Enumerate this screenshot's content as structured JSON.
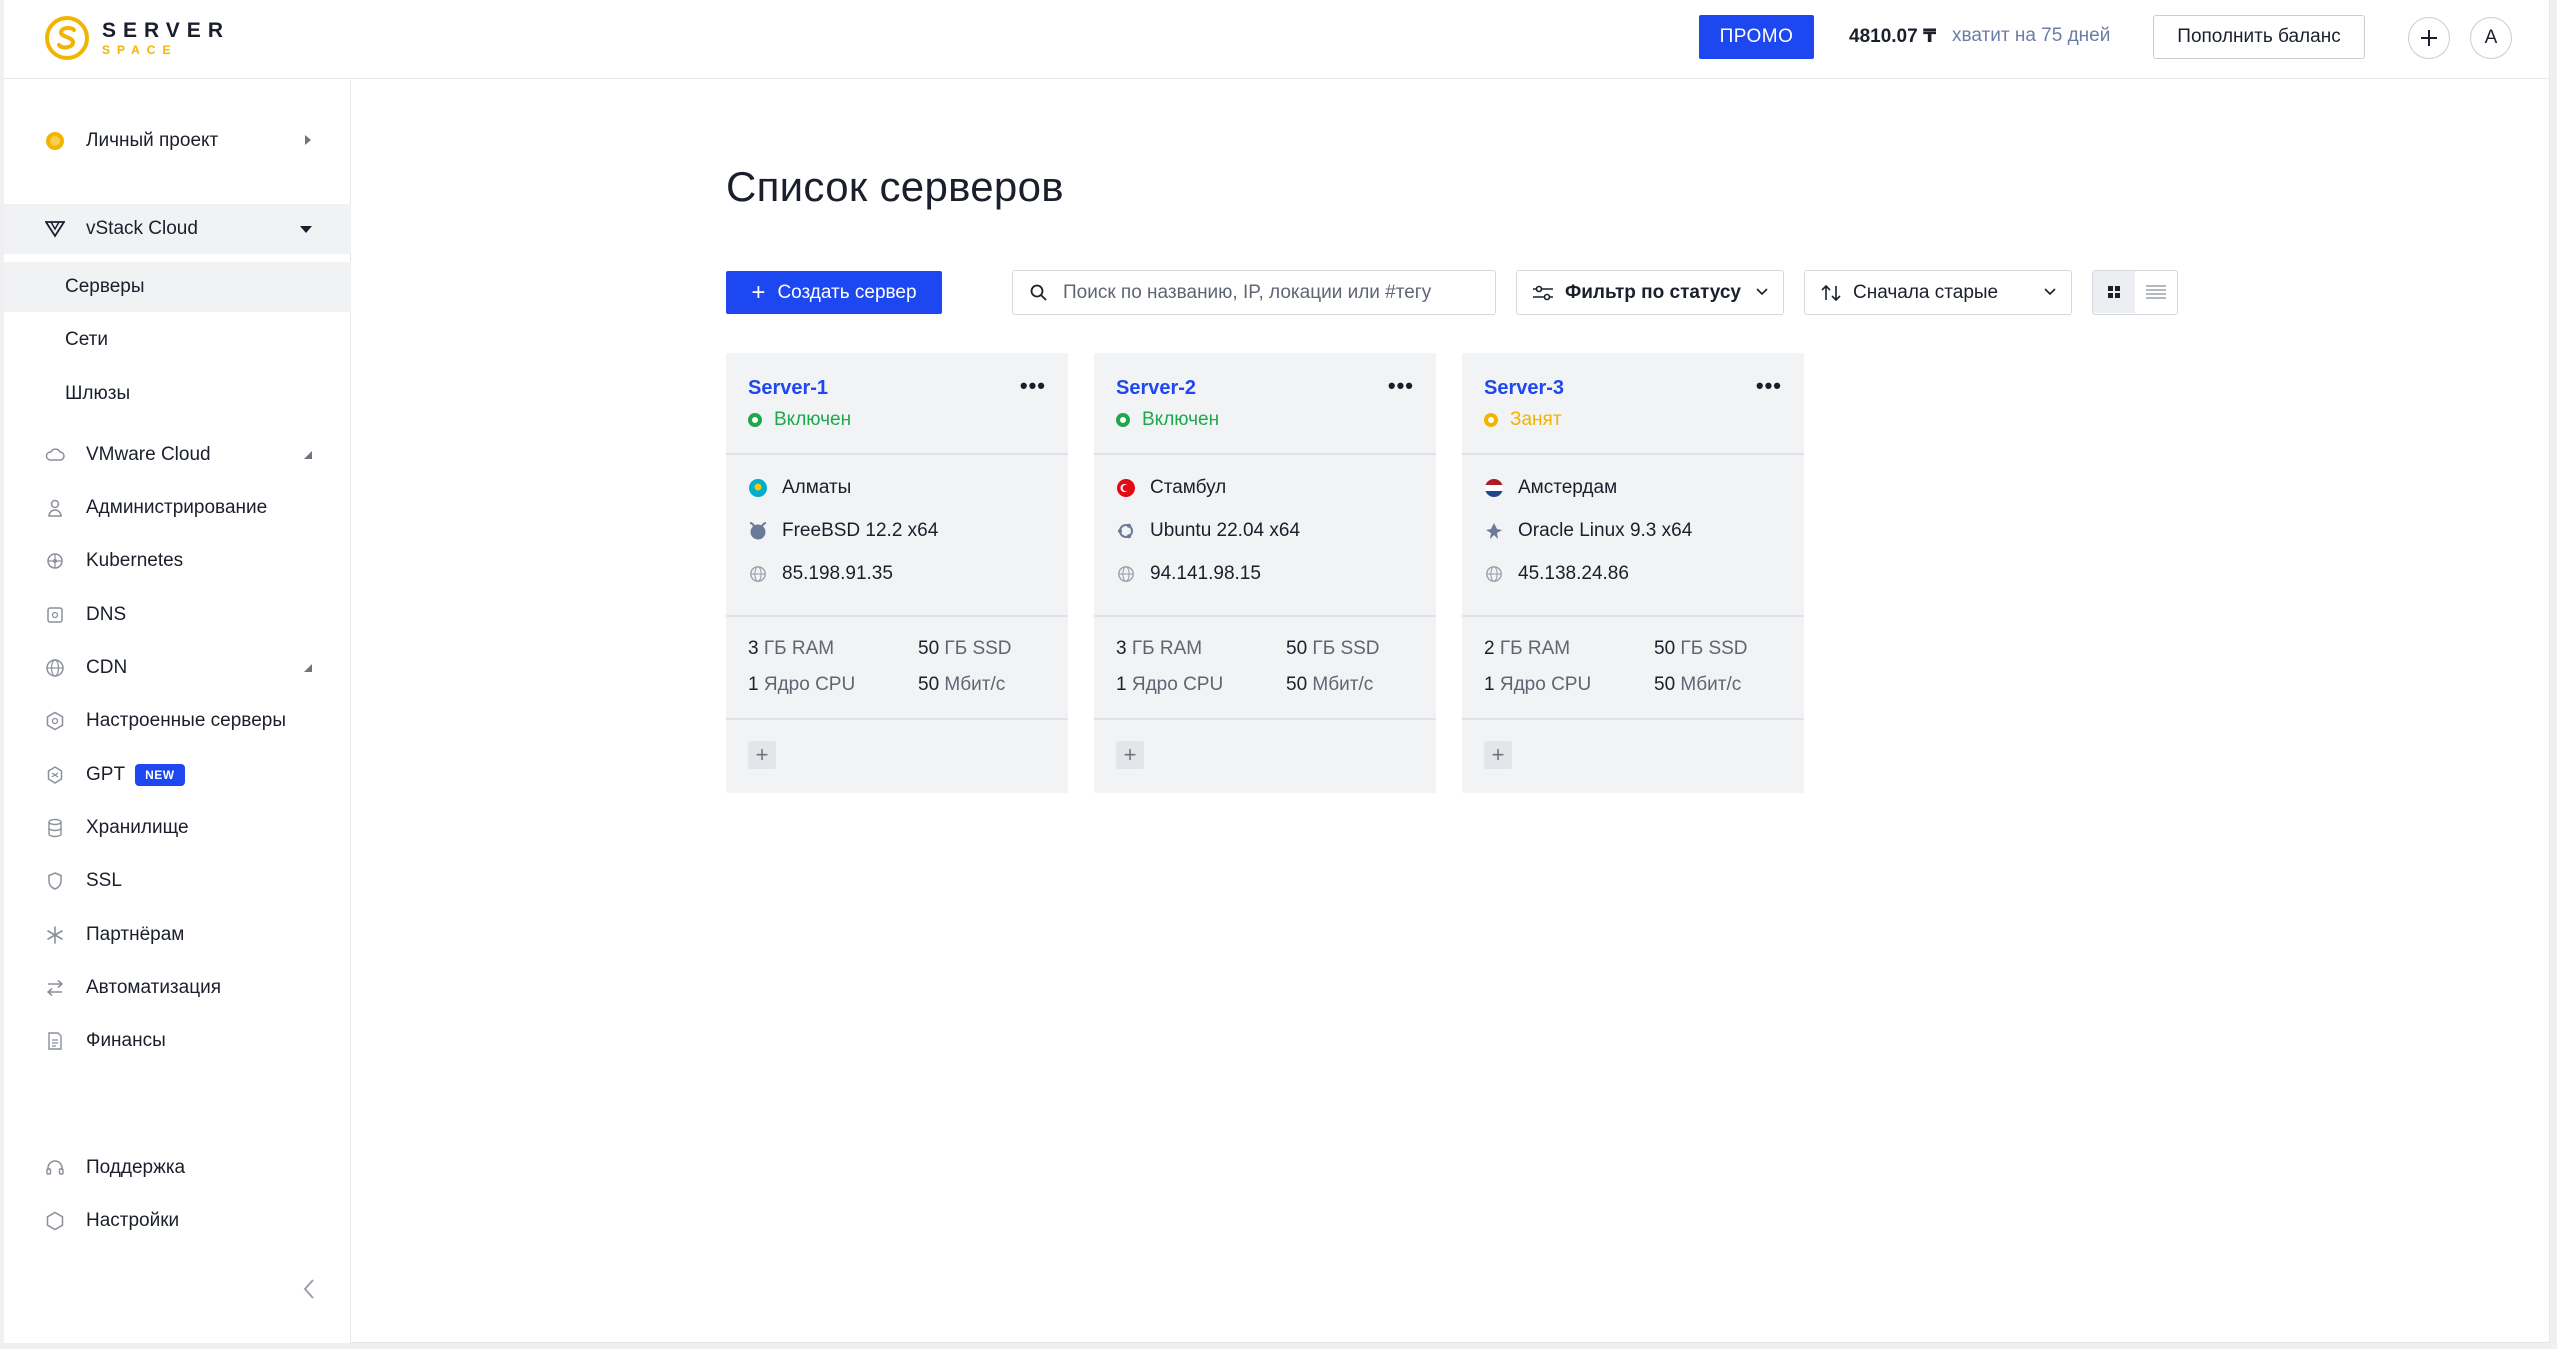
{
  "brand": {
    "line1": "SERVER",
    "line2": "SPACE",
    "accent": "#f2b400"
  },
  "header": {
    "promo_label": "ПРОМО",
    "balance": "4810.07 ₸",
    "balance_days": "хватит на 75 дней",
    "topup_label": "Пополнить баланс",
    "add_icon": "+",
    "avatar_letter": "A"
  },
  "sidebar": {
    "project": "Личный проект",
    "groups": [
      {
        "label": "vStack Cloud",
        "icon": "vstack-icon"
      },
      {
        "label": "VMware Cloud",
        "icon": "cloud-icon"
      },
      {
        "label": "Администрирование",
        "icon": "user-icon"
      },
      {
        "label": "Kubernetes",
        "icon": "kubernetes-icon"
      },
      {
        "label": "DNS",
        "icon": "dns-icon"
      },
      {
        "label": "CDN",
        "icon": "globe-icon"
      },
      {
        "label": "Настроенные серверы",
        "icon": "hexagon-icon"
      },
      {
        "label": "GPT",
        "icon": "gpt-icon",
        "badge": "NEW"
      },
      {
        "label": "Хранилище",
        "icon": "database-icon"
      },
      {
        "label": "SSL",
        "icon": "shield-icon"
      },
      {
        "label": "Партнёрам",
        "icon": "asterisk-icon"
      },
      {
        "label": "Автоматизация",
        "icon": "arrows-icon"
      },
      {
        "label": "Финансы",
        "icon": "document-icon"
      }
    ],
    "subitems": [
      "Серверы",
      "Сети",
      "Шлюзы"
    ],
    "bottom": [
      {
        "label": "Поддержка",
        "icon": "headset-icon"
      },
      {
        "label": "Настройки",
        "icon": "settings-icon"
      }
    ]
  },
  "main": {
    "title": "Список серверов",
    "create_label": "Создать сервер",
    "search_placeholder": "Поиск по названию, IP, локации или #тегу",
    "filter_label": "Фильтр по статусу",
    "sort_label": "Сначала старые"
  },
  "servers": [
    {
      "name": "Server-1",
      "status": "Включен",
      "status_color": "#1ea84c",
      "location": "Алматы",
      "flag": "kz",
      "os": "FreeBSD 12.2 x64",
      "os_icon": "freebsd-icon",
      "ip": "85.198.91.35",
      "ram_num": "3",
      "ram_unit": "ГБ RAM",
      "ssd_num": "50",
      "ssd_unit": "ГБ SSD",
      "cpu_num": "1",
      "cpu_unit": "Ядро CPU",
      "net_num": "50",
      "net_unit": "Мбит/с"
    },
    {
      "name": "Server-2",
      "status": "Включен",
      "status_color": "#1ea84c",
      "location": "Стамбул",
      "flag": "tr",
      "os": "Ubuntu 22.04 x64",
      "os_icon": "ubuntu-icon",
      "ip": "94.141.98.15",
      "ram_num": "3",
      "ram_unit": "ГБ RAM",
      "ssd_num": "50",
      "ssd_unit": "ГБ SSD",
      "cpu_num": "1",
      "cpu_unit": "Ядро CPU",
      "net_num": "50",
      "net_unit": "Мбит/с"
    },
    {
      "name": "Server-3",
      "status": "Занят",
      "status_color": "#f2b400",
      "location": "Амстердам",
      "flag": "nl",
      "os": "Oracle Linux 9.3 x64",
      "os_icon": "oracle-icon",
      "ip": "45.138.24.86",
      "ram_num": "2",
      "ram_unit": "ГБ RAM",
      "ssd_num": "50",
      "ssd_unit": "ГБ SSD",
      "cpu_num": "1",
      "cpu_unit": "Ядро CPU",
      "net_num": "50",
      "net_unit": "Мбит/с"
    }
  ]
}
